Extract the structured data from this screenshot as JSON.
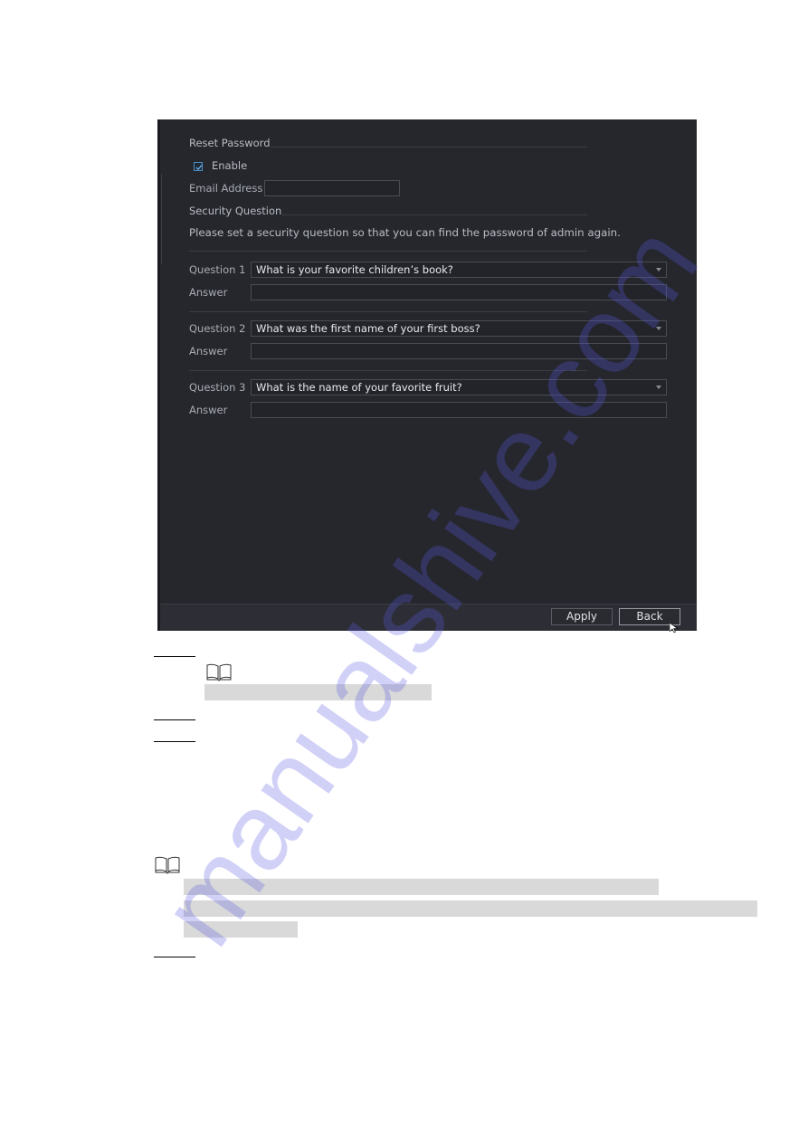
{
  "screenshot": {
    "reset_password": {
      "section_title": "Reset Password",
      "enable_label": "Enable",
      "enable_checked": true,
      "email_label": "Email Address",
      "email_value": ""
    },
    "security_question": {
      "section_title": "Security Question",
      "instruction": "Please set a security question so that you can find the password of admin again.",
      "questions": [
        {
          "label": "Question 1",
          "value": "What is your favorite children’s book?",
          "answer_label": "Answer",
          "answer_value": ""
        },
        {
          "label": "Question 2",
          "value": "What was the first name of your first boss?",
          "answer_label": "Answer",
          "answer_value": ""
        },
        {
          "label": "Question 3",
          "value": "What is the name of your favorite fruit?",
          "answer_label": "Answer",
          "answer_value": ""
        }
      ]
    },
    "footer": {
      "apply_label": "Apply",
      "back_label": "Back"
    }
  },
  "watermark": "manualshive.com"
}
